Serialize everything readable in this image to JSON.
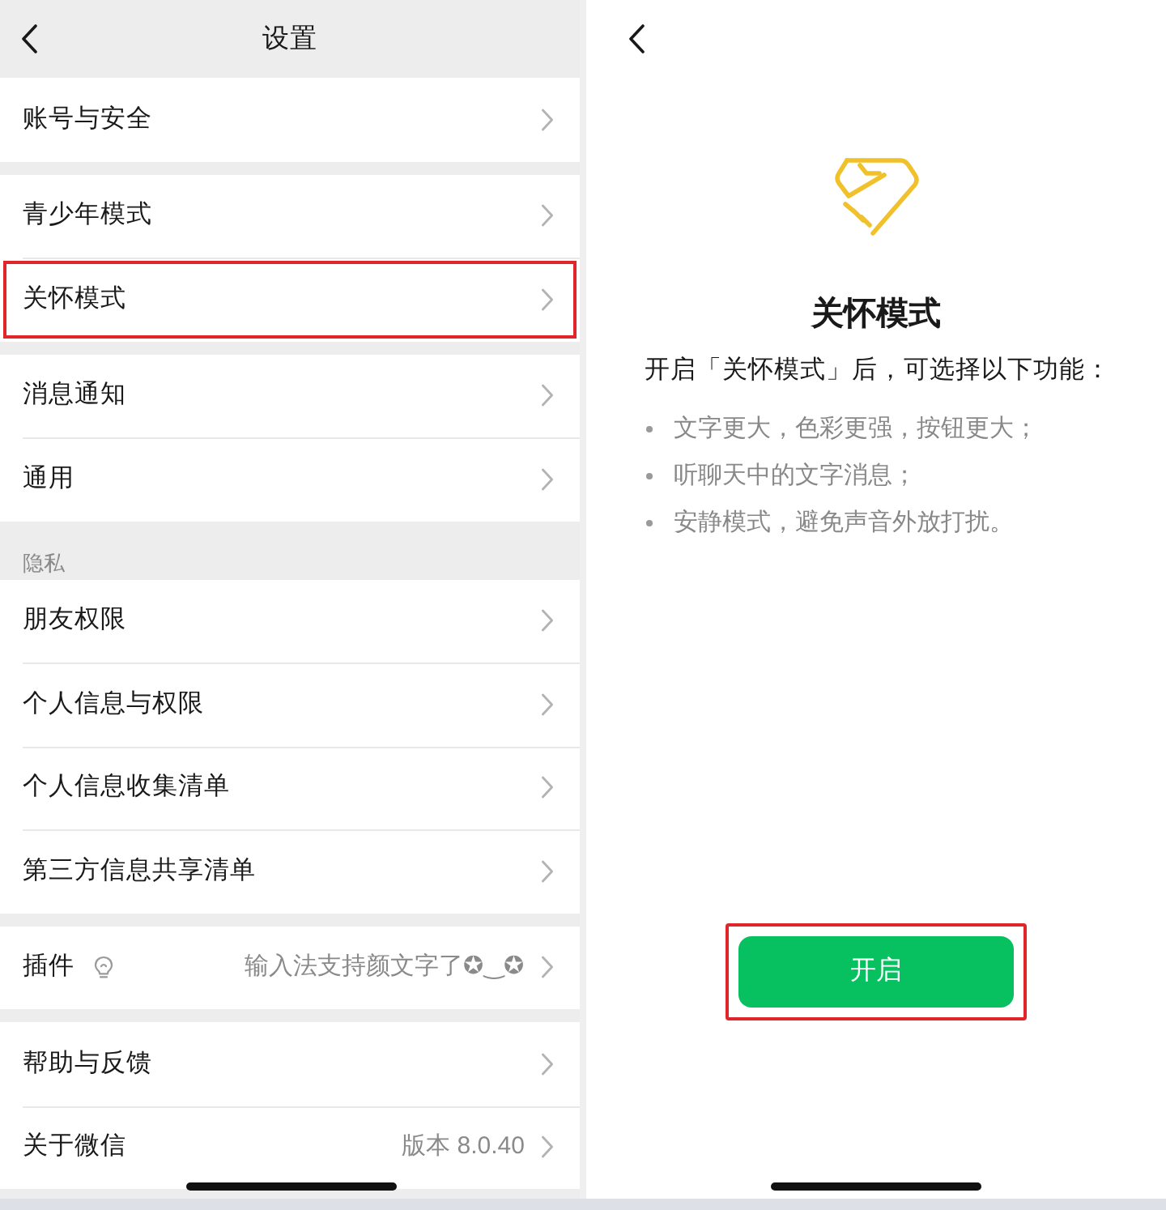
{
  "settings_screen": {
    "title": "设置",
    "groups": [
      {
        "items": [
          {
            "label": "账号与安全",
            "kind": "plain",
            "highlighted": false
          }
        ]
      },
      {
        "items": [
          {
            "label": "青少年模式",
            "kind": "plain",
            "highlighted": false
          },
          {
            "label": "关怀模式",
            "kind": "plain",
            "highlighted": true
          }
        ]
      },
      {
        "items": [
          {
            "label": "消息通知",
            "kind": "plain",
            "highlighted": false
          },
          {
            "label": "通用",
            "kind": "plain",
            "highlighted": false
          }
        ]
      },
      {
        "header": "隐私",
        "items": [
          {
            "label": "朋友权限",
            "kind": "plain",
            "highlighted": false
          },
          {
            "label": "个人信息与权限",
            "kind": "plain",
            "highlighted": false
          },
          {
            "label": "个人信息收集清单",
            "kind": "plain",
            "highlighted": false
          },
          {
            "label": "第三方信息共享清单",
            "kind": "plain",
            "highlighted": false
          }
        ]
      },
      {
        "items": [
          {
            "label": "插件",
            "kind": "hint",
            "value": "输入法支持颜文字了✪‿✪",
            "highlighted": false
          }
        ]
      },
      {
        "items": [
          {
            "label": "帮助与反馈",
            "kind": "plain",
            "highlighted": false
          },
          {
            "label": "关于微信",
            "kind": "plain",
            "value": "版本 8.0.40",
            "highlighted": false
          }
        ]
      }
    ]
  },
  "care_mode_screen": {
    "title": "关怀模式",
    "intro": "开启「关怀模式」后，可选择以下功能：",
    "features": [
      "文字更大，色彩更强，按钮更大；",
      "听聊天中的文字消息；",
      "安静模式，避免声音外放打扰。"
    ],
    "button": {
      "label": "开启",
      "highlighted": true
    }
  }
}
